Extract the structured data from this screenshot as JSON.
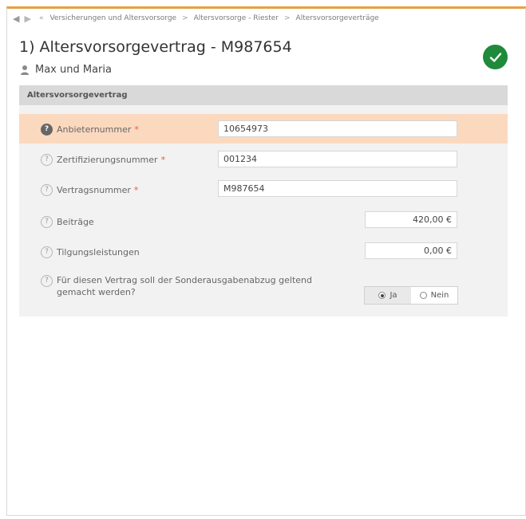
{
  "nav": {
    "back_icon": "arrow-left-icon",
    "forward_icon": "arrow-right-icon",
    "home_glyph": "«",
    "breadcrumb": [
      "Versicherungen und Altersvorsorge",
      "Altersvorsorge - Riester",
      "Altersvorsorgeverträge"
    ],
    "separator": ">"
  },
  "header": {
    "title": "1) Altersvorsorgevertrag - M987654",
    "person": "Max und Maria",
    "status_icon": "check-circle-icon",
    "accent_color": "#e8a040",
    "status_color": "#1f8a3a"
  },
  "section": {
    "title": "Altersvorsorgevertrag",
    "fields": {
      "anbieter": {
        "label": "Anbieternummer",
        "required": "*",
        "value": "10654973"
      },
      "zert": {
        "label": "Zertifizierungsnummer",
        "required": "*",
        "value": "001234"
      },
      "vertrag": {
        "label": "Vertragsnummer",
        "required": "*",
        "value": "M987654"
      },
      "beitraege": {
        "label": "Beiträge",
        "value": "420,00 €"
      },
      "tilgung": {
        "label": "Tilgungsleistungen",
        "value": "0,00 €"
      },
      "sonder": {
        "label": "Für diesen Vertrag soll der Sonderausgabenabzug geltend gemacht werden?",
        "option_yes": "Ja",
        "option_no": "Nein",
        "selected": "Ja"
      }
    },
    "help_glyph": "?",
    "highlight_color": "#fbd9bf"
  }
}
